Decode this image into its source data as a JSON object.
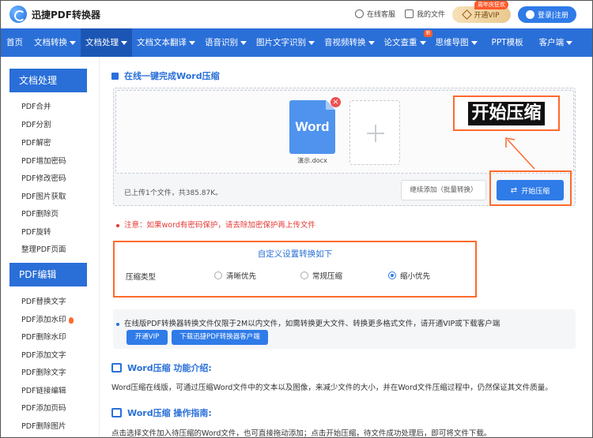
{
  "header": {
    "logo_text": "迅捷PDF转换器",
    "links": [
      {
        "label": "在线客服",
        "icon": "headset-icon"
      },
      {
        "label": "我的文件",
        "icon": "file-icon"
      }
    ],
    "vip_badge": "周年庆狂欢",
    "vip_label": "开通VIP",
    "login_label": "登录|注册"
  },
  "nav": {
    "items": [
      {
        "label": "首页",
        "caret": false,
        "active": false
      },
      {
        "label": "文档转换",
        "caret": true,
        "active": false
      },
      {
        "label": "文档处理",
        "caret": true,
        "active": true
      },
      {
        "label": "文档文本翻译",
        "caret": true,
        "active": false
      },
      {
        "label": "语音识别",
        "caret": true,
        "active": false
      },
      {
        "label": "图片文字识别",
        "caret": true,
        "active": false
      },
      {
        "label": "音视频转换",
        "caret": true,
        "active": false
      },
      {
        "label": "论文查重",
        "caret": true,
        "active": false,
        "badge": "新"
      },
      {
        "label": "思维导图",
        "caret": true,
        "active": false
      },
      {
        "label": "PPT模板",
        "caret": false,
        "active": false
      },
      {
        "label": "客户端",
        "caret": true,
        "active": false
      }
    ]
  },
  "sidebar": {
    "section1_title": "文档处理",
    "section1_items": [
      "PDF合并",
      "PDF分割",
      "PDF解密",
      "PDF增加密码",
      "PDF修改密码",
      "PDF图片获取",
      "PDF删除页",
      "PDF旋转",
      "整理PDF页面"
    ],
    "section2_title": "PDF编辑",
    "section2_items": [
      "PDF替换文字",
      "PDF添加水印",
      "PDF删除水印",
      "PDF添加文字",
      "PDF删除文字",
      "PDF链接编辑",
      "PDF添加页码",
      "PDF删除图片"
    ]
  },
  "main": {
    "title": "在线一键完成Word压缩",
    "file": {
      "icon_text": "Word",
      "name": "演示.docx"
    },
    "callout": "开始压缩",
    "status": "已上传1个文件，共385.87K。",
    "continue_label": "继续添加（批量转换）",
    "start_label": "开始压缩",
    "notice": "注意：如果word有密码保护，请去除加密保护再上传文件",
    "settings": {
      "title": "自定义设置转换如下",
      "label": "压缩类型",
      "options": [
        {
          "label": "清晰优先",
          "checked": false
        },
        {
          "label": "常规压缩",
          "checked": false
        },
        {
          "label": "缩小优先",
          "checked": true
        }
      ]
    },
    "info_text": "在线版PDF转换器转换文件仅限于2M以内文件，如需转换更大文件、转换更多格式文件，请开通VIP或下载客户端",
    "btn_vip": "开通VIP",
    "btn_download": "下载迅捷PDF转换器客户端",
    "intro_title": "Word压缩 功能介绍:",
    "intro_text": "Word压缩在线版，可通过压缩Word文件中的文本以及图像，来减少文件的大小，并在Word文件压缩过程中，仍然保证其文件质量。",
    "guide_title": "Word压缩 操作指南:",
    "guide_text": "点击选择文件加入待压缩的Word文件，也可直接拖动添加；点击开始压缩，待文件成功处理后，即可将文件下载。"
  },
  "colors": {
    "brand": "#2a6fd8",
    "highlight": "#ff6a2c",
    "notice": "#e53935"
  }
}
